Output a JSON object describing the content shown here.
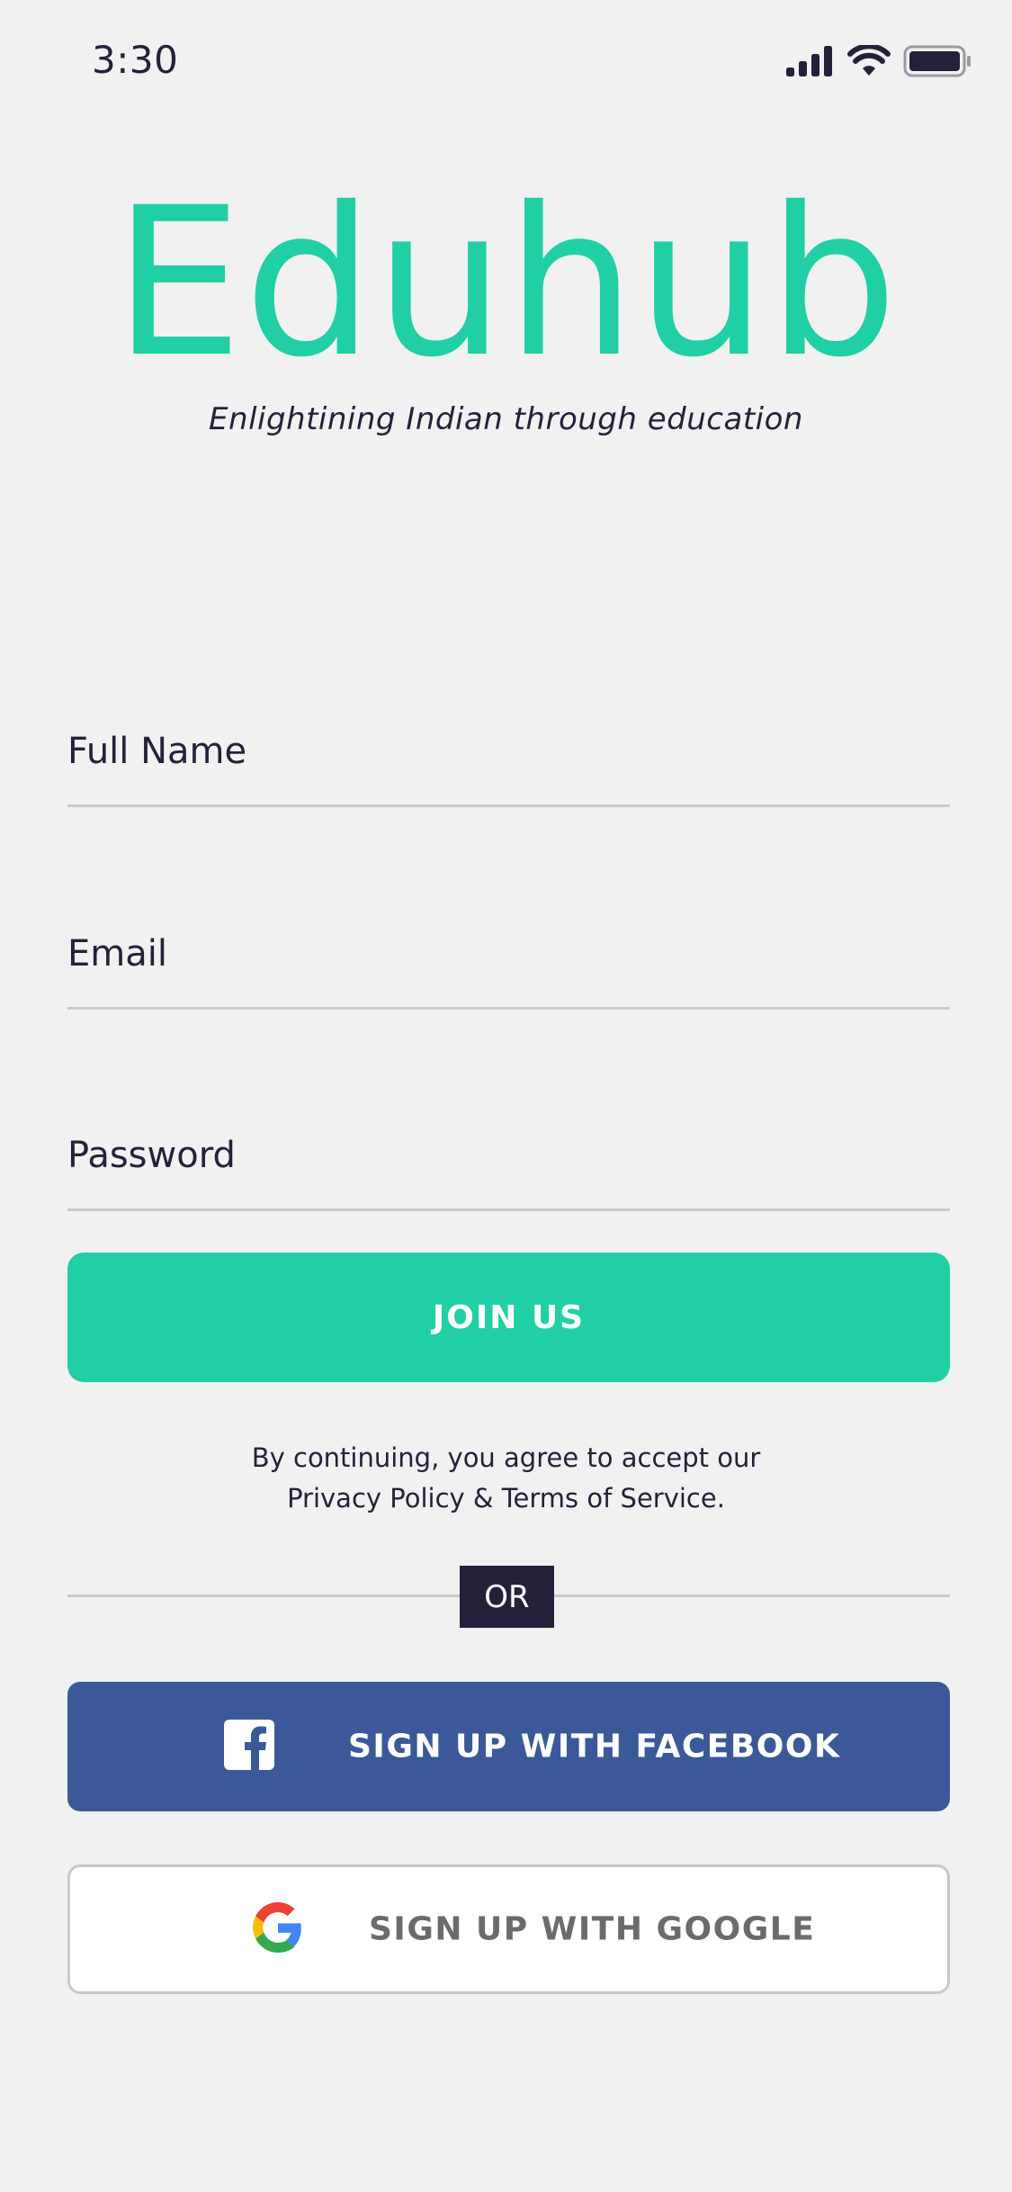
{
  "status_bar": {
    "time": "3:30",
    "icons": [
      "signal-icon",
      "wifi-icon",
      "battery-icon"
    ]
  },
  "brand": {
    "name": "Eduhub",
    "tagline": "Enlightining Indian through education",
    "color": "#20cfa5"
  },
  "form": {
    "full_name": {
      "placeholder": "Full Name",
      "value": ""
    },
    "email": {
      "placeholder": "Email",
      "value": ""
    },
    "password": {
      "placeholder": "Password",
      "value": ""
    },
    "submit_label": "JOIN US"
  },
  "terms": {
    "line1": "By continuing, you agree to accept our",
    "line2": "Privacy Policy & Terms of Service."
  },
  "divider": {
    "label": "OR"
  },
  "social": {
    "facebook": {
      "label": "SIGN UP WITH FACEBOOK",
      "icon": "facebook-icon",
      "color": "#3b5998"
    },
    "google": {
      "label": "SIGN UP WITH GOOGLE",
      "icon": "google-icon"
    }
  },
  "colors": {
    "accent": "#20cfa5",
    "text_dark": "#23223a",
    "background": "#f1f1f1",
    "facebook": "#3b5998"
  }
}
